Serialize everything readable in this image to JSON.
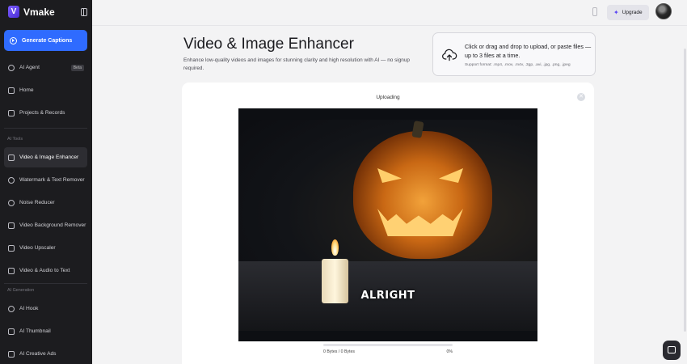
{
  "app": {
    "name": "Vmake"
  },
  "sidebar": {
    "cta_label": "Generate Captions",
    "top_items": [
      {
        "label": "AI Agent",
        "badge": "Beta"
      },
      {
        "label": "Home"
      },
      {
        "label": "Projects & Records"
      }
    ],
    "sections": [
      {
        "title": "AI Tools",
        "items": [
          {
            "label": "Video & Image Enhancer",
            "active": true
          },
          {
            "label": "Watermark & Text Remover"
          },
          {
            "label": "Noise Reducer"
          },
          {
            "label": "Video Background Remover"
          },
          {
            "label": "Video Upscaler"
          },
          {
            "label": "Video & Audio to Text"
          }
        ]
      },
      {
        "title": "AI Generation",
        "items": [
          {
            "label": "AI Hook"
          },
          {
            "label": "AI Thumbnail"
          },
          {
            "label": "AI Creative Ads"
          }
        ]
      }
    ]
  },
  "topbar": {
    "upgrade_label": "Upgrade"
  },
  "hero": {
    "title": "Video & Image Enhancer",
    "subtitle": "Enhance low-quality videos and images for stunning clarity and high resolution with AI — no signup required."
  },
  "upload": {
    "text": "Click or drag and drop to upload, or paste files — up to 3 files at a time.",
    "formats": "Support format: .mp4, .mov, .m4v, .3gp, .avi, .jpg, .png, .jpeg"
  },
  "card": {
    "status": "Uploading",
    "preview_caption": "ALRIGHT",
    "bytes_text": "0 Bytes / 0 Bytes",
    "percent_text": "0%",
    "progress": 0
  },
  "colors": {
    "accent": "#2f6bff",
    "sidebar_bg": "#1c1c1f"
  }
}
